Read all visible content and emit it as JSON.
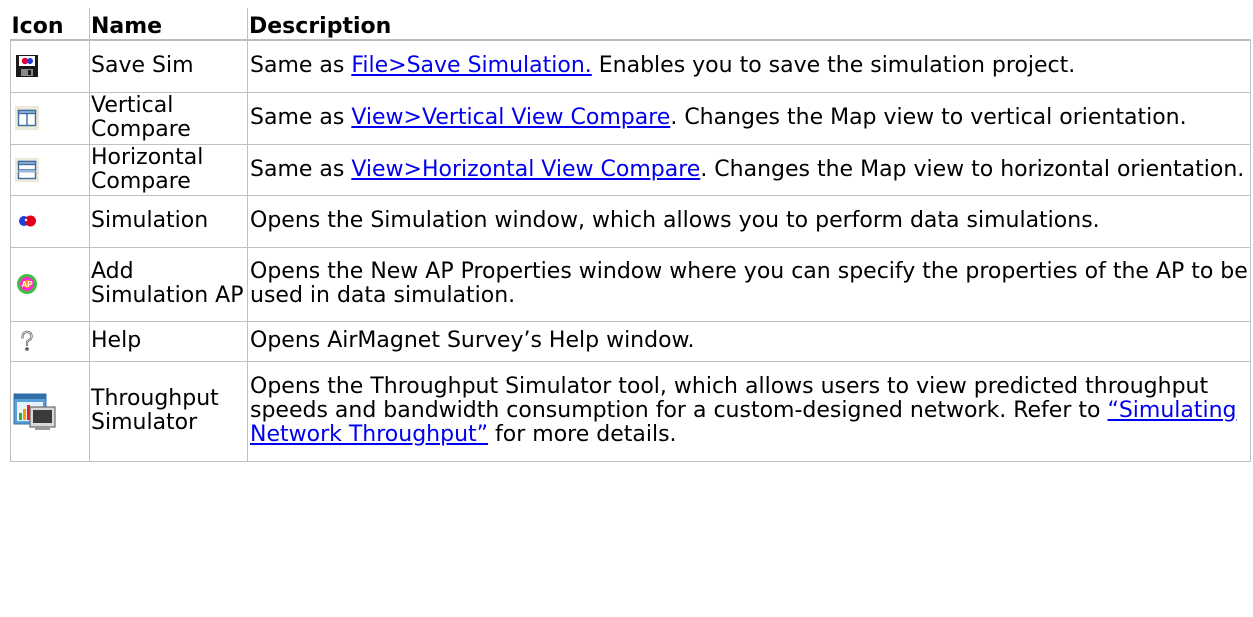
{
  "headers": {
    "icon": "Icon",
    "name": "Name",
    "description": "Description"
  },
  "rows": [
    {
      "icon": "save-sim-icon",
      "name": "Save Sim",
      "pre": "Same as ",
      "link": "File>Save Simulation.",
      "post": " Enables you to save the simulation project."
    },
    {
      "icon": "vertical-compare-icon",
      "name": "Vertical Compare",
      "pre": "Same as ",
      "link": "View>Vertical View Compare",
      "post": ". Changes the Map view to vertical orientation."
    },
    {
      "icon": "horizontal-compare-icon",
      "name": "Horizontal Compare",
      "pre": "Same as ",
      "link": "View>Horizontal View Compare",
      "post": ". Changes the Map view to horizontal orientation."
    },
    {
      "icon": "simulation-icon",
      "name": "Simulation",
      "pre": "Opens the Simulation window, which allows you to perform data simulations.",
      "link": "",
      "post": ""
    },
    {
      "icon": "add-simulation-ap-icon",
      "name": "Add Simulation AP",
      "pre": "Opens the New AP Properties window where you can specify the properties of the AP to be used in data simulation.",
      "link": "",
      "post": ""
    },
    {
      "icon": "help-icon",
      "name": "Help",
      "pre": "Opens AirMagnet Survey’s Help window.",
      "link": "",
      "post": ""
    },
    {
      "icon": "throughput-simulator-icon",
      "name": "Throughput Simulator",
      "pre": "Opens the Throughput Simulator tool, which allows users to view predicted throughput speeds and bandwidth consumption for a custom-designed network. Refer to ",
      "link": "“Simulating Network Throughput”",
      "post": " for more details."
    }
  ]
}
